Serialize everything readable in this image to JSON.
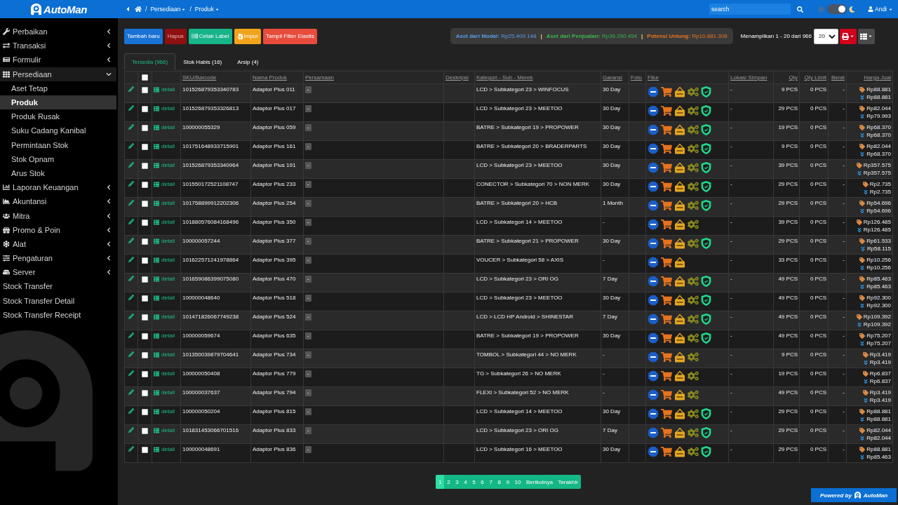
{
  "topbar": {
    "brand": "AutoMan",
    "breadcrumb": {
      "separator": "/",
      "items": [
        {
          "label": "Persediaan"
        },
        {
          "label": "Produk"
        }
      ]
    },
    "search": {
      "placeholder": "search"
    },
    "dark_mode": {
      "on": true
    },
    "user": "Andi"
  },
  "sidebar": {
    "items": [
      {
        "label": "Perbaikan",
        "kind": "group",
        "expanded": false
      },
      {
        "label": "Transaksi",
        "kind": "group",
        "expanded": false
      },
      {
        "label": "Formulir",
        "kind": "group",
        "expanded": false
      },
      {
        "label": "Persediaan",
        "kind": "group",
        "expanded": true,
        "children": [
          {
            "label": "Aset Tetap",
            "selected": false
          },
          {
            "label": "Produk",
            "selected": true
          },
          {
            "label": "Produk Rusak",
            "selected": false
          },
          {
            "label": "Suku Cadang Kanibal",
            "selected": false
          },
          {
            "label": "Permintaan Stok",
            "selected": false
          },
          {
            "label": "Stok Opnam",
            "selected": false
          },
          {
            "label": "Arus Stok",
            "selected": false
          }
        ]
      },
      {
        "label": "Laporan Keuangan",
        "kind": "group",
        "expanded": false
      },
      {
        "label": "Akuntansi",
        "kind": "group",
        "expanded": false
      },
      {
        "label": "Mitra",
        "kind": "group",
        "expanded": false
      },
      {
        "label": "Promo & Poin",
        "kind": "group",
        "expanded": false
      },
      {
        "label": "Alat",
        "kind": "group",
        "expanded": false
      },
      {
        "label": "Pengaturan",
        "kind": "group",
        "expanded": false
      },
      {
        "label": "Server",
        "kind": "group",
        "expanded": false
      },
      {
        "label": "Stock Transfer",
        "kind": "link",
        "selected": false
      },
      {
        "label": "Stock Transfer Detail",
        "kind": "link",
        "selected": false
      },
      {
        "label": "Stock Transfer Receipt",
        "kind": "link",
        "selected": false
      }
    ]
  },
  "toolbar": {
    "buttons": [
      {
        "label": "Tambah baru",
        "kind": "add",
        "color": "#1a73d4"
      },
      {
        "label": "Hapus",
        "kind": "delete",
        "color": "#8e1010"
      },
      {
        "label": "Cetak Label",
        "kind": "print",
        "color": "#17b389"
      },
      {
        "label": "Impor",
        "kind": "import",
        "color": "#f1a31b"
      },
      {
        "label": "Tampil Filter Elastis",
        "kind": "filter",
        "color": "#e74c3c"
      }
    ]
  },
  "summary": {
    "separator": "|",
    "stats": [
      {
        "text": "**Aset dari Modal:** Rp25.409.148",
        "color": "#5b9be6"
      },
      {
        "text": "**Aset dari Penjualan:** Rp36.290.454",
        "color": "#3cb450"
      },
      {
        "text": "**Potensi Untung:** Rp10.881.306",
        "color": "#e8741e"
      }
    ]
  },
  "paging": {
    "info": "Menampilkan 1 - 20 dari 966",
    "page_size": "20"
  },
  "tabs": [
    {
      "label": "Tersedia (966)",
      "selected": true
    },
    {
      "label": "Stok Habis (16)",
      "selected": false
    },
    {
      "label": "Arsip (4)",
      "selected": false
    }
  ],
  "table": {
    "select_all": {
      "checked": false
    },
    "columns": [
      "SKU/Barcode",
      "Nama Produk",
      "Persamaan",
      "Deskripsi",
      "Kategori - Sub - Merek",
      "Garansi",
      "Foto",
      "Fitur",
      "Lokasi Simpan",
      "Qty",
      "Qty Limit",
      "Berat",
      "Harga Jual"
    ],
    "rows": [
      {
        "checked": false,
        "detail": "detail",
        "sku": "101526879353340783",
        "name": "Adaptor Plus 011",
        "similar": "-",
        "category": "LCD > Subkategori 23 > WINFOCUS",
        "warranty": "30 Day",
        "features": [
          {
            "kind": "new"
          },
          {
            "kind": "cart"
          },
          {
            "kind": "sale"
          },
          {
            "kind": "service"
          },
          {
            "kind": "warranty"
          }
        ],
        "location": "-",
        "qty": "9 PCS",
        "qty_limit": "0 PCS",
        "weight": "-",
        "price": "Rp88.881",
        "min_price": "Rp88.881"
      },
      {
        "checked": false,
        "detail": "detail",
        "sku": "101526879353326813",
        "name": "Adaptor Plus 017",
        "similar": "-",
        "category": "LCD > Subkategori 23 > MEETOO",
        "warranty": "30 Day",
        "features": [
          {
            "kind": "new"
          },
          {
            "kind": "cart"
          },
          {
            "kind": "sale"
          },
          {
            "kind": "service"
          },
          {
            "kind": "warranty"
          }
        ],
        "location": "-",
        "qty": "29 PCS",
        "qty_limit": "0 PCS",
        "weight": "-",
        "price": "Rp82.044",
        "min_price": "Rp79.993"
      },
      {
        "checked": false,
        "detail": "detail",
        "sku": "100000055329",
        "name": "Adaptor Plus 059",
        "similar": "-",
        "category": "BATRE > Subkategori 19 > PROPOWER",
        "warranty": "30 Day",
        "features": [
          {
            "kind": "new"
          },
          {
            "kind": "cart"
          },
          {
            "kind": "sale"
          },
          {
            "kind": "service"
          },
          {
            "kind": "warranty"
          }
        ],
        "location": "-",
        "qty": "19 PCS",
        "qty_limit": "0 PCS",
        "weight": "-",
        "price": "Rp68.370",
        "min_price": "Rp68.370"
      },
      {
        "checked": false,
        "detail": "detail",
        "sku": "101751648933715901",
        "name": "Adaptor Plus 161",
        "similar": "-",
        "category": "BATRE > Subkategori 20 > BRADERPARTS",
        "warranty": "30 Day",
        "features": [
          {
            "kind": "new"
          },
          {
            "kind": "cart"
          },
          {
            "kind": "sale"
          },
          {
            "kind": "service"
          },
          {
            "kind": "warranty"
          }
        ],
        "location": "-",
        "qty": "9 PCS",
        "qty_limit": "0 PCS",
        "weight": "-",
        "price": "Rp82.044",
        "min_price": "Rp68.370"
      },
      {
        "checked": false,
        "detail": "detail",
        "sku": "101526879353340964",
        "name": "Adaptor Plus 191",
        "similar": "-",
        "category": "LCD > Subkategori 23 > MEETOO",
        "warranty": "30 Day",
        "features": [
          {
            "kind": "new"
          },
          {
            "kind": "cart"
          },
          {
            "kind": "sale"
          },
          {
            "kind": "service"
          },
          {
            "kind": "warranty"
          }
        ],
        "location": "-",
        "qty": "39 PCS",
        "qty_limit": "0 PCS",
        "weight": "-",
        "price": "Rp357.575",
        "min_price": "Rp357.575"
      },
      {
        "checked": false,
        "detail": "detail",
        "sku": "101550172521108747",
        "name": "Adaptor Plus 233",
        "similar": "-",
        "category": "CONECTOR > Subkategori 70 > NON MERK",
        "warranty": "30 Day",
        "features": [
          {
            "kind": "new"
          },
          {
            "kind": "cart"
          },
          {
            "kind": "sale"
          },
          {
            "kind": "service"
          },
          {
            "kind": "warranty"
          }
        ],
        "location": "-",
        "qty": "29 PCS",
        "qty_limit": "0 PCS",
        "weight": "-",
        "price": "Rp2.735",
        "min_price": "Rp2.735"
      },
      {
        "checked": false,
        "detail": "detail",
        "sku": "101758899912202306",
        "name": "Adaptor Plus 254",
        "similar": "-",
        "category": "BATRE > Subkategori 20 > HCB",
        "warranty": "1 Month",
        "features": [
          {
            "kind": "new"
          },
          {
            "kind": "cart"
          },
          {
            "kind": "sale"
          },
          {
            "kind": "service"
          },
          {
            "kind": "warranty"
          }
        ],
        "location": "-",
        "qty": "29 PCS",
        "qty_limit": "0 PCS",
        "weight": "-",
        "price": "Rp54.696",
        "min_price": "Rp54.696"
      },
      {
        "checked": false,
        "detail": "detail",
        "sku": "101880576084168496",
        "name": "Adaptor Plus 350",
        "similar": "-",
        "category": "LCD > Subkategori 14 > MEETOO",
        "warranty": "-",
        "features": [
          {
            "kind": "new"
          },
          {
            "kind": "cart"
          },
          {
            "kind": "sale"
          },
          {
            "kind": "service"
          }
        ],
        "location": "-",
        "qty": "39 PCS",
        "qty_limit": "0 PCS",
        "weight": "-",
        "price": "Rp126.485",
        "min_price": "Rp126.485"
      },
      {
        "checked": false,
        "detail": "detail",
        "sku": "100000057244",
        "name": "Adaptor Plus 377",
        "similar": "-",
        "category": "BATRE > Subkategori 21 > PROPOWER",
        "warranty": "30 Day",
        "features": [
          {
            "kind": "new"
          },
          {
            "kind": "cart"
          },
          {
            "kind": "sale"
          },
          {
            "kind": "service"
          },
          {
            "kind": "warranty"
          }
        ],
        "location": "-",
        "qty": "29 PCS",
        "qty_limit": "0 PCS",
        "weight": "-",
        "price": "Rp61.533",
        "min_price": "Rp58.115"
      },
      {
        "checked": false,
        "detail": "detail",
        "sku": "101622571241978864",
        "name": "Adaptor Plus 395",
        "similar": "-",
        "category": "VOUCER > Subkategori 58 > AXIS",
        "warranty": "-",
        "features": [
          {
            "kind": "new"
          },
          {
            "kind": "cart"
          },
          {
            "kind": "sale"
          }
        ],
        "location": "-",
        "qty": "33 PCS",
        "qty_limit": "0 PCS",
        "weight": "-",
        "price": "Rp10.256",
        "min_price": "Rp10.256"
      },
      {
        "checked": false,
        "detail": "detail",
        "sku": "101659086399075080",
        "name": "Adaptor Plus 470",
        "similar": "-",
        "category": "LCD > Subkategori 23 > ORI OG",
        "warranty": "7 Day",
        "features": [
          {
            "kind": "new"
          },
          {
            "kind": "cart"
          },
          {
            "kind": "sale"
          },
          {
            "kind": "service"
          },
          {
            "kind": "warranty"
          }
        ],
        "location": "-",
        "qty": "49 PCS",
        "qty_limit": "0 PCS",
        "weight": "-",
        "price": "Rp85.463",
        "min_price": "Rp85.463"
      },
      {
        "checked": false,
        "detail": "detail",
        "sku": "100000048640",
        "name": "Adaptor Plus 518",
        "similar": "-",
        "category": "LCD > Subkategori 23 > MEETOO",
        "warranty": "30 Day",
        "features": [
          {
            "kind": "new"
          },
          {
            "kind": "cart"
          },
          {
            "kind": "sale"
          },
          {
            "kind": "service"
          },
          {
            "kind": "warranty"
          }
        ],
        "location": "-",
        "qty": "49 PCS",
        "qty_limit": "0 PCS",
        "weight": "-",
        "price": "Rp92.300",
        "min_price": "Rp92.300"
      },
      {
        "checked": false,
        "detail": "detail",
        "sku": "101471826067749238",
        "name": "Adaptor Plus 524",
        "similar": "-",
        "category": "LCD > LCD HP Android > SHINESTAR",
        "warranty": "7 Day",
        "features": [
          {
            "kind": "new"
          },
          {
            "kind": "cart"
          },
          {
            "kind": "sale"
          },
          {
            "kind": "service"
          },
          {
            "kind": "warranty"
          }
        ],
        "location": "-",
        "qty": "49 PCS",
        "qty_limit": "0 PCS",
        "weight": "-",
        "price": "Rp109.392",
        "min_price": "Rp109.392"
      },
      {
        "checked": false,
        "detail": "detail",
        "sku": "100000059674",
        "name": "Adaptor Plus 635",
        "similar": "-",
        "category": "BATRE > Subkategori 19 > PROPOWER",
        "warranty": "30 Day",
        "features": [
          {
            "kind": "new"
          },
          {
            "kind": "cart"
          },
          {
            "kind": "sale"
          },
          {
            "kind": "service"
          },
          {
            "kind": "warranty"
          }
        ],
        "location": "-",
        "qty": "49 PCS",
        "qty_limit": "0 PCS",
        "weight": "-",
        "price": "Rp75.207",
        "min_price": "Rp75.207"
      },
      {
        "checked": false,
        "detail": "detail",
        "sku": "101350039879704641",
        "name": "Adaptor Plus 734",
        "similar": "-",
        "category": "TOMBOL > Subkategori 44 > NO MERK",
        "warranty": "-",
        "features": [
          {
            "kind": "new"
          },
          {
            "kind": "cart"
          },
          {
            "kind": "sale"
          },
          {
            "kind": "service"
          }
        ],
        "location": "-",
        "qty": "9 PCS",
        "qty_limit": "0 PCS",
        "weight": "-",
        "price": "Rp3.419",
        "min_price": "Rp3.419"
      },
      {
        "checked": false,
        "detail": "detail",
        "sku": "100000050408",
        "name": "Adaptor Plus 779",
        "similar": "-",
        "category": "TG > Subkategori 26 > NO MERK",
        "warranty": "-",
        "features": [
          {
            "kind": "new"
          },
          {
            "kind": "cart"
          },
          {
            "kind": "sale"
          },
          {
            "kind": "service"
          }
        ],
        "location": "-",
        "qty": "19 PCS",
        "qty_limit": "0 PCS",
        "weight": "-",
        "price": "Rp6.837",
        "min_price": "Rp6.837"
      },
      {
        "checked": false,
        "detail": "detail",
        "sku": "100000037637",
        "name": "Adaptor Plus 794",
        "similar": "-",
        "category": "FLEXI > Subkategori 52 > NO MERK",
        "warranty": "-",
        "features": [
          {
            "kind": "new"
          },
          {
            "kind": "cart"
          },
          {
            "kind": "sale"
          },
          {
            "kind": "service"
          }
        ],
        "location": "-",
        "qty": "49 PCS",
        "qty_limit": "0 PCS",
        "weight": "-",
        "price": "Rp3.419",
        "min_price": "Rp3.419"
      },
      {
        "checked": false,
        "detail": "detail",
        "sku": "100000050204",
        "name": "Adaptor Plus 815",
        "similar": "-",
        "category": "LCD > Subkategori 14 > MEETOO",
        "warranty": "30 Day",
        "features": [
          {
            "kind": "new"
          },
          {
            "kind": "cart"
          },
          {
            "kind": "sale"
          },
          {
            "kind": "service"
          },
          {
            "kind": "warranty"
          }
        ],
        "location": "-",
        "qty": "29 PCS",
        "qty_limit": "0 PCS",
        "weight": "-",
        "price": "Rp88.881",
        "min_price": "Rp88.881"
      },
      {
        "checked": false,
        "detail": "detail",
        "sku": "101831453066701516",
        "name": "Adaptor Plus 833",
        "similar": "-",
        "category": "LCD > Subkategori 23 > ORI OG",
        "warranty": "7 Day",
        "features": [
          {
            "kind": "new"
          },
          {
            "kind": "cart"
          },
          {
            "kind": "sale"
          },
          {
            "kind": "service"
          },
          {
            "kind": "warranty"
          }
        ],
        "location": "-",
        "qty": "29 PCS",
        "qty_limit": "0 PCS",
        "weight": "-",
        "price": "Rp82.044",
        "min_price": "Rp82.044"
      },
      {
        "checked": false,
        "detail": "detail",
        "sku": "100000048691",
        "name": "Adaptor Plus 836",
        "similar": "-",
        "category": "LCD > Subkategori 16 > MEETOO",
        "warranty": "30 Day",
        "features": [
          {
            "kind": "new"
          },
          {
            "kind": "cart"
          },
          {
            "kind": "sale"
          },
          {
            "kind": "service"
          },
          {
            "kind": "warranty"
          }
        ],
        "location": "-",
        "qty": "29 PCS",
        "qty_limit": "0 PCS",
        "weight": "-",
        "price": "Rp88.881",
        "min_price": "Rp85.463"
      }
    ]
  },
  "pagination": [
    {
      "label": "1",
      "selected": true
    },
    {
      "label": "2",
      "selected": false
    },
    {
      "label": "3",
      "selected": false
    },
    {
      "label": "4",
      "selected": false
    },
    {
      "label": "5",
      "selected": false
    },
    {
      "label": "6",
      "selected": false
    },
    {
      "label": "7",
      "selected": false
    },
    {
      "label": "8",
      "selected": false
    },
    {
      "label": "9",
      "selected": false
    },
    {
      "label": "10",
      "selected": false
    },
    {
      "label": "Berikutnya",
      "selected": false
    },
    {
      "label": "Terakhir",
      "selected": false
    }
  ],
  "powered_by": {
    "text": "Powered by",
    "brand": "AutoMan"
  }
}
